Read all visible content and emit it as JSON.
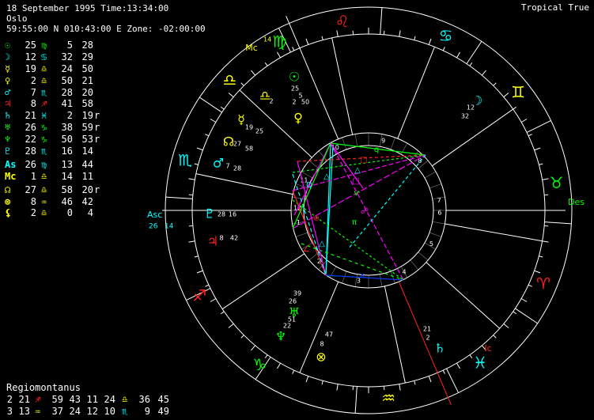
{
  "header": {
    "date_time": "18 September 1995 Time:13:34:00",
    "place": "Oslo",
    "coords": "59:55:00 N 010:43:00 E Zone: -02:00:00",
    "mode": "Tropical True"
  },
  "positions": [
    {
      "glyph": "☉",
      "glyph_color": "#00ff00",
      "deg": "25",
      "sign": "♍",
      "sign_color": "#00ff00",
      "min": "5",
      "sec": "28",
      "flag": ""
    },
    {
      "glyph": "☽",
      "glyph_color": "#00ffff",
      "deg": "12",
      "sign": "♋",
      "sign_color": "#00ffff",
      "min": "32",
      "sec": "29",
      "flag": ""
    },
    {
      "glyph": "☿",
      "glyph_color": "#ffff00",
      "deg": "19",
      "sign": "♎",
      "sign_color": "#ffff00",
      "min": "24",
      "sec": "50",
      "flag": ""
    },
    {
      "glyph": "♀",
      "glyph_color": "#ffff00",
      "deg": "2",
      "sign": "♎",
      "sign_color": "#ffff00",
      "min": "50",
      "sec": "21",
      "flag": ""
    },
    {
      "glyph": "♂",
      "glyph_color": "#00ffff",
      "deg": "7",
      "sign": "♏",
      "sign_color": "#00ffff",
      "min": "28",
      "sec": "20",
      "flag": ""
    },
    {
      "glyph": "♃",
      "glyph_color": "#ff2020",
      "deg": "8",
      "sign": "♐",
      "sign_color": "#ff2020",
      "min": "41",
      "sec": "58",
      "flag": ""
    },
    {
      "glyph": "♄",
      "glyph_color": "#00ffff",
      "deg": "21",
      "sign": "♓",
      "sign_color": "#00ffff",
      "min": "2",
      "sec": "19",
      "flag": "r"
    },
    {
      "glyph": "♅",
      "glyph_color": "#00ff00",
      "deg": "26",
      "sign": "♑",
      "sign_color": "#00ff00",
      "min": "38",
      "sec": "59",
      "flag": "r"
    },
    {
      "glyph": "♆",
      "glyph_color": "#00ff00",
      "deg": "22",
      "sign": "♑",
      "sign_color": "#00ff00",
      "min": "50",
      "sec": "53",
      "flag": "r"
    },
    {
      "glyph": "♇",
      "glyph_color": "#00ffff",
      "deg": "28",
      "sign": "♏",
      "sign_color": "#00ffff",
      "min": "16",
      "sec": "14",
      "flag": ""
    },
    {
      "glyph": "As",
      "glyph_color": "#00ffff",
      "deg": "26",
      "sign": "♍",
      "sign_color": "#00ffff",
      "min": "13",
      "sec": "44",
      "flag": ""
    },
    {
      "glyph": "Mc",
      "glyph_color": "#ffff00",
      "deg": "1",
      "sign": "♎",
      "sign_color": "#ffff00",
      "min": "14",
      "sec": "11",
      "flag": ""
    },
    {
      "glyph": "☊",
      "glyph_color": "#ffff00",
      "deg": "27",
      "sign": "♎",
      "sign_color": "#ffff00",
      "min": "58",
      "sec": "20",
      "flag": "r"
    },
    {
      "glyph": "⊗",
      "glyph_color": "#ffff00",
      "deg": "8",
      "sign": "♒",
      "sign_color": "#ffff00",
      "min": "46",
      "sec": "42",
      "flag": ""
    },
    {
      "glyph": "⚸",
      "glyph_color": "#ffff00",
      "deg": "2",
      "sign": "♎",
      "sign_color": "#ffff00",
      "min": "0",
      "sec": "4",
      "flag": ""
    }
  ],
  "houses": {
    "title": "Regiomontanus",
    "rows": [
      {
        "n": "2",
        "d1": "21",
        "s1": "♐",
        "s1_color": "#ff2020",
        "m1": "59",
        "n2": "43",
        "h": "11",
        "d2": "24",
        "s2": "♎",
        "s2_color": "#ffff00",
        "m2": "36",
        "n3": "45"
      },
      {
        "n": "3",
        "d1": "13",
        "s1": "♒",
        "s1_color": "#ffff00",
        "m1": "37",
        "n2": "24",
        "h": "12",
        "d2": "10",
        "s2": "♏",
        "s2_color": "#00ffff",
        "m2": "9",
        "n3": "49"
      }
    ]
  },
  "chart": {
    "axis_labels": {
      "asc": "Asc",
      "des": "Des",
      "mc": "Mc",
      "ic": "Ic",
      "asc_deg": "26",
      "asc_min": "14",
      "mc_deg": "14"
    },
    "zodiac": [
      {
        "sym": "♌",
        "color": "#ff2020"
      },
      {
        "sym": "♋",
        "color": "#00ffff"
      },
      {
        "sym": "♊",
        "color": "#ffff00"
      },
      {
        "sym": "♉",
        "color": "#00ff00"
      },
      {
        "sym": "♈",
        "color": "#ff2020"
      },
      {
        "sym": "♓",
        "color": "#00ffff"
      },
      {
        "sym": "♒",
        "color": "#ffff00"
      },
      {
        "sym": "♑",
        "color": "#00ff00"
      },
      {
        "sym": "♐",
        "color": "#ff2020"
      },
      {
        "sym": "♏",
        "color": "#00ffff"
      },
      {
        "sym": "♎",
        "color": "#ffff00"
      },
      {
        "sym": "♍",
        "color": "#00ff00"
      }
    ],
    "house_numbers": [
      "1",
      "2",
      "3",
      "4",
      "5",
      "6",
      "7",
      "8",
      "9",
      "10",
      "11",
      "12"
    ],
    "planets": [
      {
        "sym": "☉",
        "color": "#00ff00",
        "deg": "25",
        "min": "5"
      },
      {
        "sym": "♀",
        "color": "#ffff00",
        "deg": "2",
        "min": "50"
      },
      {
        "sym": "♎",
        "color": "#ffff00",
        "deg": "2",
        "min": ""
      },
      {
        "sym": "☿",
        "color": "#ffff00",
        "deg": "19",
        "min": "25"
      },
      {
        "sym": "☊",
        "color": "#ffff00",
        "deg": "27",
        "min": "58"
      },
      {
        "sym": "♂",
        "color": "#00ffff",
        "deg": "7",
        "min": "28"
      },
      {
        "sym": "♇",
        "color": "#00ffff",
        "deg": "28",
        "min": "16"
      },
      {
        "sym": "♃",
        "color": "#ff2020",
        "deg": "8",
        "min": "42"
      },
      {
        "sym": "♆",
        "color": "#00ff00",
        "deg": "22",
        "min": "51"
      },
      {
        "sym": "♅",
        "color": "#00ff00",
        "deg": "26",
        "min": "39"
      },
      {
        "sym": "⊗",
        "color": "#ffff00",
        "deg": "8",
        "min": "47"
      },
      {
        "sym": "♄",
        "color": "#00ffff",
        "deg": "2",
        "min": "21"
      },
      {
        "sym": "☽",
        "color": "#00ffff",
        "deg": "12",
        "min": "32"
      }
    ],
    "aspect_glyphs": [
      {
        "sym": "q",
        "color": "#00ff00"
      },
      {
        "sym": "□",
        "color": "#ff2020"
      },
      {
        "sym": "△",
        "color": "#00ffff"
      },
      {
        "sym": "□",
        "color": "#ff00ff"
      },
      {
        "sym": "ⱱ",
        "color": "#00ff00"
      },
      {
        "sym": "π",
        "color": "#00ff00"
      },
      {
        "sym": "☍",
        "color": "#ff00ff"
      },
      {
        "sym": "×",
        "color": "#0040ff"
      },
      {
        "sym": "Q",
        "color": "#00ffff"
      },
      {
        "sym": "∠",
        "color": "#ff2020"
      },
      {
        "sym": "⊕",
        "color": "#ff2020"
      },
      {
        "sym": "△",
        "color": "#00ffff"
      },
      {
        "sym": "△",
        "color": "#00ffff"
      }
    ]
  }
}
